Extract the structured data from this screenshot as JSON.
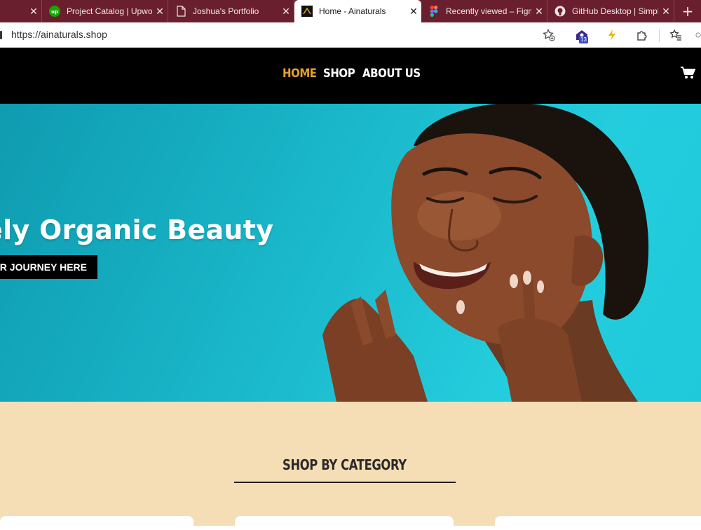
{
  "browser": {
    "tabs": [
      {
        "title": "",
        "favicon": "blank"
      },
      {
        "title": "Project Catalog | Upwork",
        "favicon": "upwork-icon"
      },
      {
        "title": "Joshua's Portfolio",
        "favicon": "document-icon"
      },
      {
        "title": "Home - Ainaturals",
        "favicon": "ainaturals-icon",
        "active": true
      },
      {
        "title": "Recently viewed – Figma",
        "favicon": "figma-icon"
      },
      {
        "title": "GitHub Desktop | Simple",
        "favicon": "github-icon"
      }
    ],
    "new_tab": "+",
    "close": "✕",
    "url": "https://ainaturals.shop",
    "extension_badge": "13"
  },
  "nav": {
    "links": [
      "HOME",
      "SHOP",
      "ABOUT US"
    ],
    "active_link": "HOME",
    "cart_icon": "cart-icon"
  },
  "hero": {
    "title": "ely Organic Beauty",
    "cta": "UR JOURNEY HERE"
  },
  "category": {
    "heading": "SHOP BY CATEGORY"
  },
  "colors": {
    "tabbar": "#6a1f2e",
    "nav_bg": "#000000",
    "nav_active": "#e3a22a",
    "hero_bg": "#19b5c8",
    "section_bg": "#f5deb5"
  }
}
